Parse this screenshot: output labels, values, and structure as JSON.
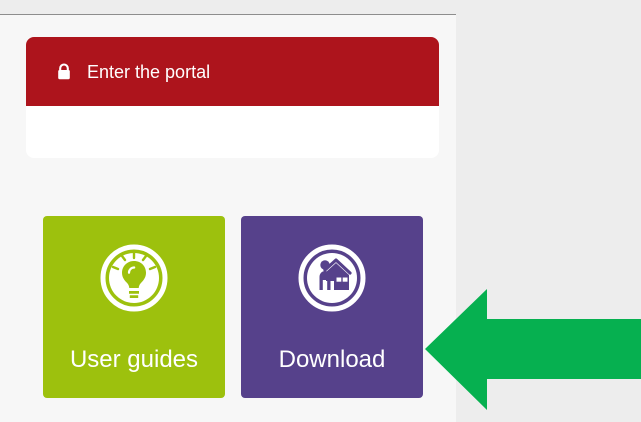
{
  "portal": {
    "label": "Enter the portal",
    "icon": "lock-icon",
    "color": "#ad141c"
  },
  "tiles": [
    {
      "label": "User guides",
      "icon": "lightbulb-icon",
      "color": "#9dc10d"
    },
    {
      "label": "Download",
      "icon": "home-person-icon",
      "color": "#56418b"
    }
  ],
  "annotation": {
    "arrow_color": "#06b050",
    "icon": "arrow-left-icon"
  },
  "panel": {
    "background": "#f7f7f7",
    "page_background": "#ededed"
  }
}
